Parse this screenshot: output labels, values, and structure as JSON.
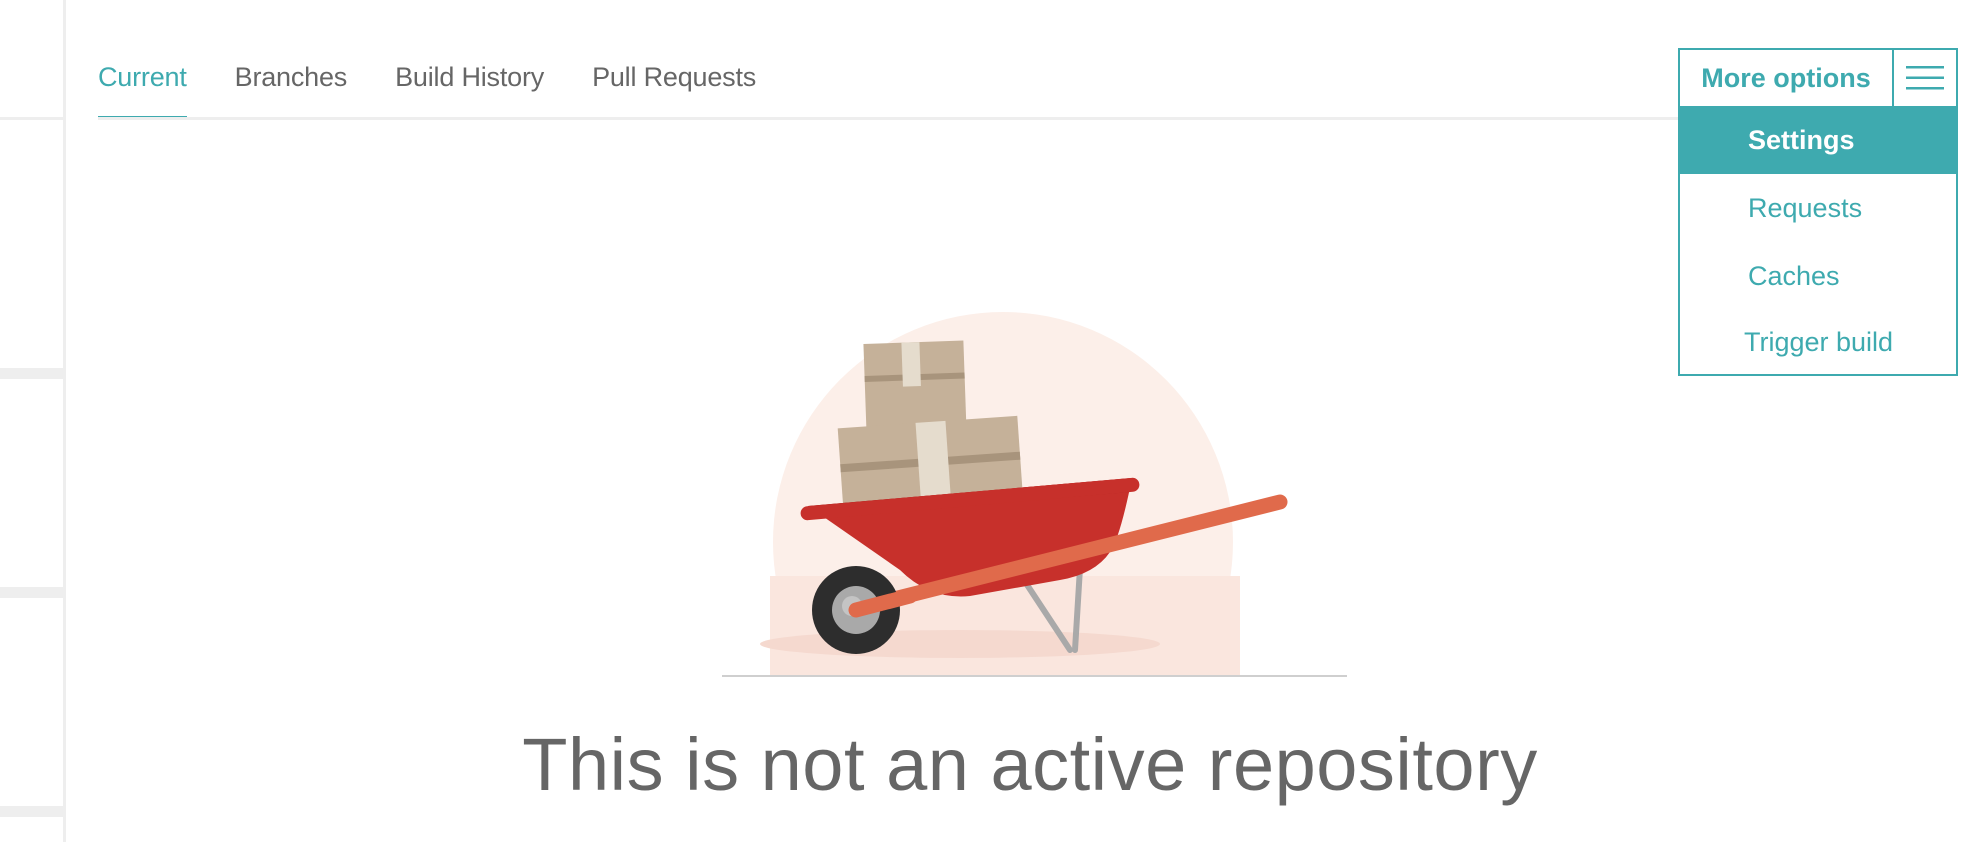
{
  "tabs": [
    {
      "label": "Current",
      "active": true
    },
    {
      "label": "Branches",
      "active": false
    },
    {
      "label": "Build History",
      "active": false
    },
    {
      "label": "Pull Requests",
      "active": false
    }
  ],
  "dropdown": {
    "title": "More options",
    "menu_icon": "hamburger-icon",
    "items": [
      {
        "label": "Settings",
        "selected": true
      },
      {
        "label": "Requests",
        "selected": false
      },
      {
        "label": "Caches",
        "selected": false
      },
      {
        "label": "Trigger build",
        "selected": false
      }
    ]
  },
  "empty_state": {
    "illustration": "wheelbarrow-with-boxes",
    "heading": "This is not an active repository"
  },
  "colors": {
    "accent": "#3eaaaf",
    "text_muted": "#666666",
    "wheelbarrow_red": "#c7302b",
    "handle_orange": "#e06a4b",
    "box_tan": "#c5b199",
    "circle_bg": "#fcefe9"
  }
}
